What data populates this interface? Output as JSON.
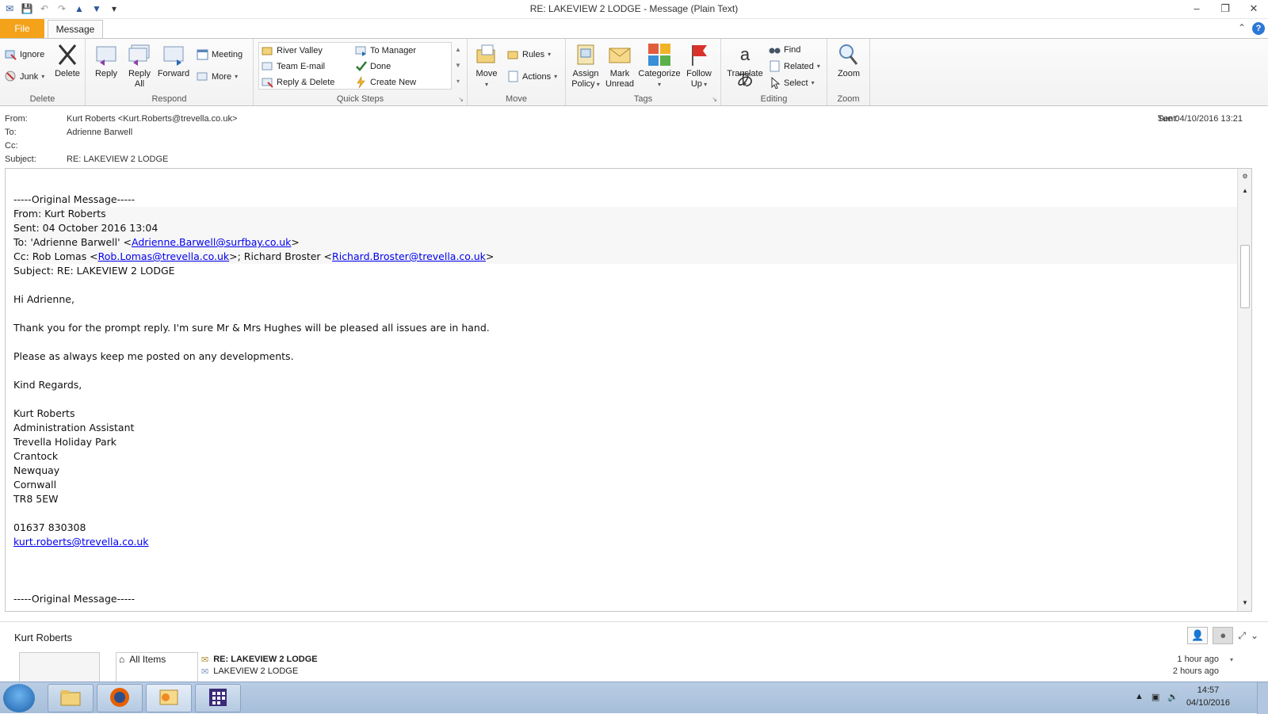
{
  "window": {
    "title": "RE: LAKEVIEW 2 LODGE  -  Message (Plain Text)",
    "controls": {
      "minimize": "–",
      "restore": "❐",
      "close": "✕"
    }
  },
  "tabs": {
    "file": "File",
    "message": "Message"
  },
  "ribbon": {
    "delete_group": {
      "label": "Delete",
      "ignore": "Ignore",
      "junk": "Junk",
      "delete": "Delete"
    },
    "respond_group": {
      "label": "Respond",
      "reply": "Reply",
      "reply_all_1": "Reply",
      "reply_all_2": "All",
      "forward": "Forward",
      "meeting": "Meeting",
      "more": "More"
    },
    "quicksteps_group": {
      "label": "Quick Steps",
      "items": [
        "River Valley",
        "Team E-mail",
        "Reply & Delete",
        "To Manager",
        "Done",
        "Create New"
      ]
    },
    "move_group": {
      "label": "Move",
      "move": "Move",
      "rules": "Rules",
      "actions": "Actions"
    },
    "tags_group": {
      "label": "Tags",
      "assign_1": "Assign",
      "assign_2": "Policy",
      "mark_1": "Mark",
      "mark_2": "Unread",
      "categorize": "Categorize",
      "follow_1": "Follow",
      "follow_2": "Up"
    },
    "editing_group": {
      "label": "Editing",
      "translate": "Translate",
      "find": "Find",
      "related": "Related",
      "select": "Select"
    },
    "zoom_group": {
      "label": "Zoom",
      "zoom": "Zoom"
    }
  },
  "header": {
    "from_label": "From:",
    "from_value": "Kurt Roberts <Kurt.Roberts@trevella.co.uk>",
    "to_label": "To:",
    "to_value": "Adrienne Barwell",
    "cc_label": "Cc:",
    "cc_value": "",
    "subject_label": "Subject:",
    "subject_value": "RE: LAKEVIEW 2 LODGE",
    "sent_label": "Sent:",
    "sent_value": "Tue 04/10/2016 13:21"
  },
  "body": {
    "orig1": "-----Original Message-----",
    "from": "From: Kurt Roberts",
    "sent": "Sent: 04 October 2016 13:04",
    "to_prefix": "To: 'Adrienne Barwell' <",
    "to_link": "Adrienne.Barwell@surfbay.co.uk",
    "to_suffix": ">",
    "cc_prefix": "Cc: Rob Lomas <",
    "cc_link1": "Rob.Lomas@trevella.co.uk",
    "cc_mid": ">; Richard Broster <",
    "cc_link2": "Richard.Broster@trevella.co.uk",
    "cc_suffix": ">",
    "subject": "Subject: RE: LAKEVIEW 2 LODGE",
    "greeting": "Hi Adrienne,",
    "para1": "Thank you for the prompt reply. I'm sure Mr & Mrs Hughes will be pleased all issues are in hand.",
    "para2": "Please as always keep me posted on any developments.",
    "closing": "Kind Regards,",
    "sig": [
      "Kurt Roberts",
      "Administration Assistant",
      "Trevella Holiday Park",
      "Crantock",
      "Newquay",
      "Cornwall",
      "TR8 5EW"
    ],
    "phone": "01637 830308",
    "email": "kurt.roberts@trevella.co.uk",
    "orig2": "-----Original Message-----"
  },
  "people_pane": {
    "name": "Kurt Roberts",
    "all_items": "All Items",
    "items": [
      {
        "subject": "RE: LAKEVIEW 2 LODGE",
        "ago": "1 hour ago"
      },
      {
        "subject": "LAKEVIEW 2 LODGE",
        "ago": "2 hours ago"
      }
    ]
  },
  "taskbar": {
    "time": "14:57",
    "date": "04/10/2016"
  }
}
